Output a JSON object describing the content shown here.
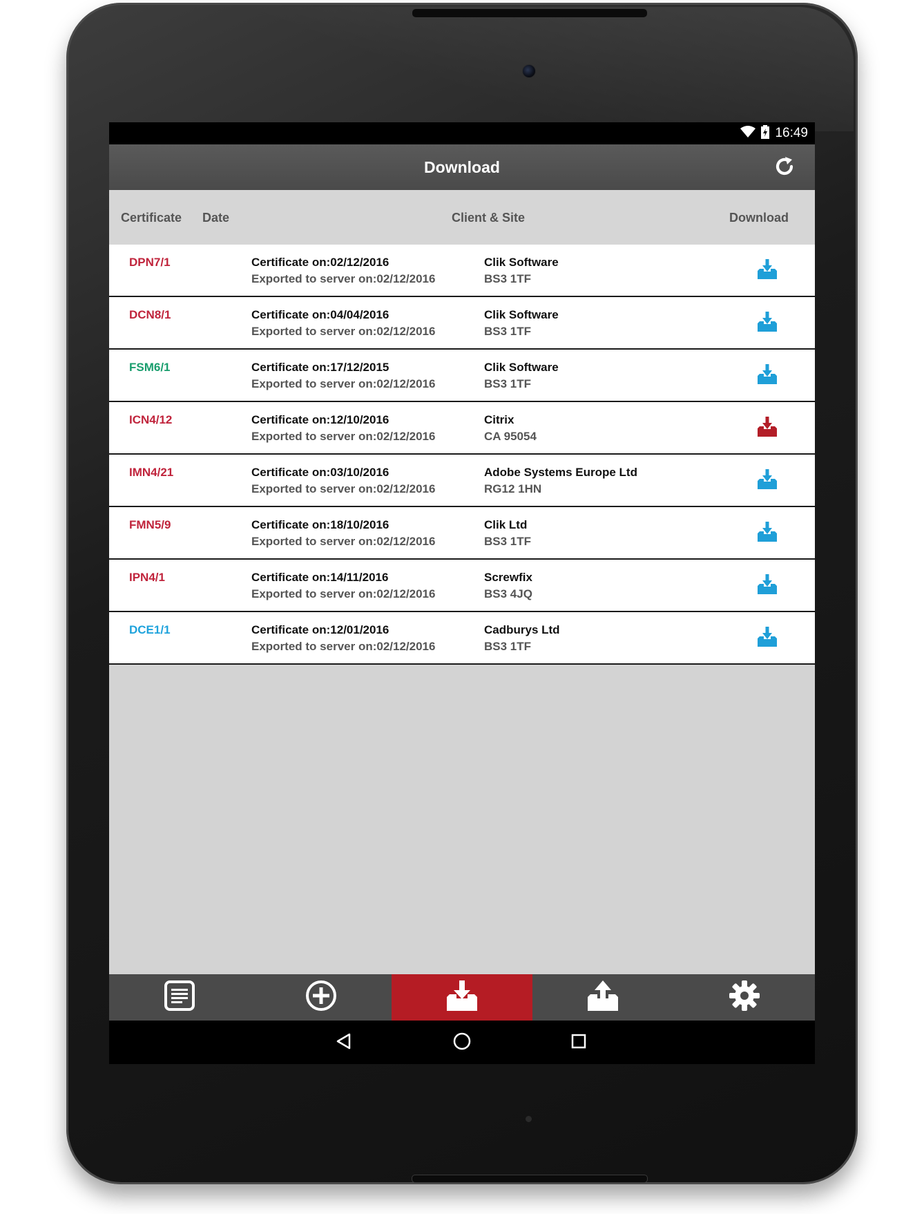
{
  "status_bar": {
    "time": "16:49"
  },
  "app_bar": {
    "title": "Download",
    "refresh_icon": "refresh-icon"
  },
  "table_header": {
    "certificate": "Certificate",
    "date": "Date",
    "client_site": "Client & Site",
    "download": "Download"
  },
  "colors": {
    "red_text": "#c0243c",
    "green_text": "#1a9e6e",
    "blue_text": "#1fa3dc",
    "icon_blue": "#1f9fd8",
    "icon_red": "#b31e28",
    "active_tab": "#b51c24"
  },
  "rows": [
    {
      "cert": "DPN7/1",
      "cert_color": "red",
      "cert_date": "Certificate on:02/12/2016",
      "export_date": "Exported to server on:02/12/2016",
      "client": "Clik Software",
      "site": "BS3 1TF",
      "icon_color": "blue"
    },
    {
      "cert": "DCN8/1",
      "cert_color": "red",
      "cert_date": "Certificate on:04/04/2016",
      "export_date": "Exported to server on:02/12/2016",
      "client": "Clik Software",
      "site": "BS3 1TF",
      "icon_color": "blue"
    },
    {
      "cert": "FSM6/1",
      "cert_color": "green",
      "cert_date": "Certificate on:17/12/2015",
      "export_date": "Exported to server on:02/12/2016",
      "client": "Clik Software",
      "site": "BS3 1TF",
      "icon_color": "blue"
    },
    {
      "cert": "ICN4/12",
      "cert_color": "red",
      "cert_date": "Certificate on:12/10/2016",
      "export_date": "Exported to server on:02/12/2016",
      "client": "Citrix",
      "site": "CA 95054",
      "icon_color": "red"
    },
    {
      "cert": "IMN4/21",
      "cert_color": "red",
      "cert_date": "Certificate on:03/10/2016",
      "export_date": "Exported to server on:02/12/2016",
      "client": "Adobe Systems Europe Ltd",
      "site": "RG12 1HN",
      "icon_color": "blue"
    },
    {
      "cert": "FMN5/9",
      "cert_color": "red",
      "cert_date": "Certificate on:18/10/2016",
      "export_date": "Exported to server on:02/12/2016",
      "client": "Clik Ltd",
      "site": "BS3 1TF",
      "icon_color": "blue"
    },
    {
      "cert": "IPN4/1",
      "cert_color": "red",
      "cert_date": "Certificate on:14/11/2016",
      "export_date": "Exported to server on:02/12/2016",
      "client": "Screwfix",
      "site": "BS3 4JQ",
      "icon_color": "blue"
    },
    {
      "cert": "DCE1/1",
      "cert_color": "blue",
      "cert_date": "Certificate on:12/01/2016",
      "export_date": "Exported to server on:02/12/2016",
      "client": "Cadburys Ltd",
      "site": "BS3 1TF",
      "icon_color": "blue"
    }
  ],
  "bottom_nav": [
    {
      "icon": "document-list-icon",
      "active": false
    },
    {
      "icon": "add-circle-icon",
      "active": false
    },
    {
      "icon": "download-tray-icon",
      "active": true
    },
    {
      "icon": "upload-tray-icon",
      "active": false
    },
    {
      "icon": "settings-gear-icon",
      "active": false
    }
  ],
  "android_nav": [
    {
      "icon": "back-triangle-icon"
    },
    {
      "icon": "home-circle-icon"
    },
    {
      "icon": "recents-square-icon"
    }
  ]
}
